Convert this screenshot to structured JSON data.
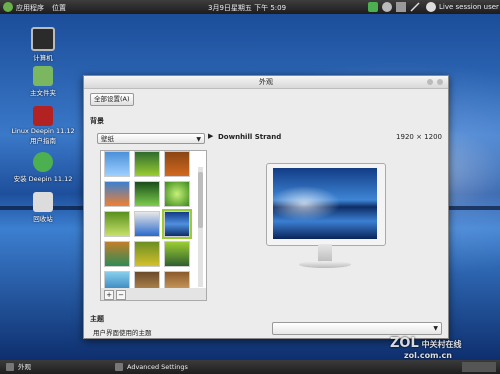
{
  "top_panel": {
    "menus": [
      "应用程序",
      "位置"
    ],
    "clock": "3月9日星期五 下午 5:09",
    "session_user": "Live session user"
  },
  "desktop_icons": [
    {
      "label": "计算机",
      "icon": "computer-icon"
    },
    {
      "label": "主文件夹",
      "icon": "home-folder-icon"
    },
    {
      "label": "Linux Deepin 11.12\n用户指南",
      "icon": "user-guide-icon"
    },
    {
      "label": "安装 Deepin 11.12",
      "icon": "install-icon"
    },
    {
      "label": "回收站",
      "icon": "trash-icon"
    }
  ],
  "window": {
    "title": "外观",
    "all_settings_label": "全部设置(A)",
    "background_section": "背景",
    "wallpaper_combo_value": "壁纸",
    "wallpaper_name": "Downhill Strand",
    "wallpaper_resolution": "1920 × 1200",
    "add_label": "+",
    "remove_label": "−",
    "theme_section": "主题",
    "theme_label": "用户界面使用的主题",
    "theme_combo_value": ""
  },
  "taskbar": {
    "tasks": [
      "外观",
      "Advanced Settings"
    ]
  },
  "watermark": {
    "text": "中关村在线",
    "logo": "ZOL",
    "domain": "zol.com.cn"
  },
  "colors": {
    "selection_accent": "#9acd32",
    "wallpaper_blue": "#1e4f9c"
  }
}
